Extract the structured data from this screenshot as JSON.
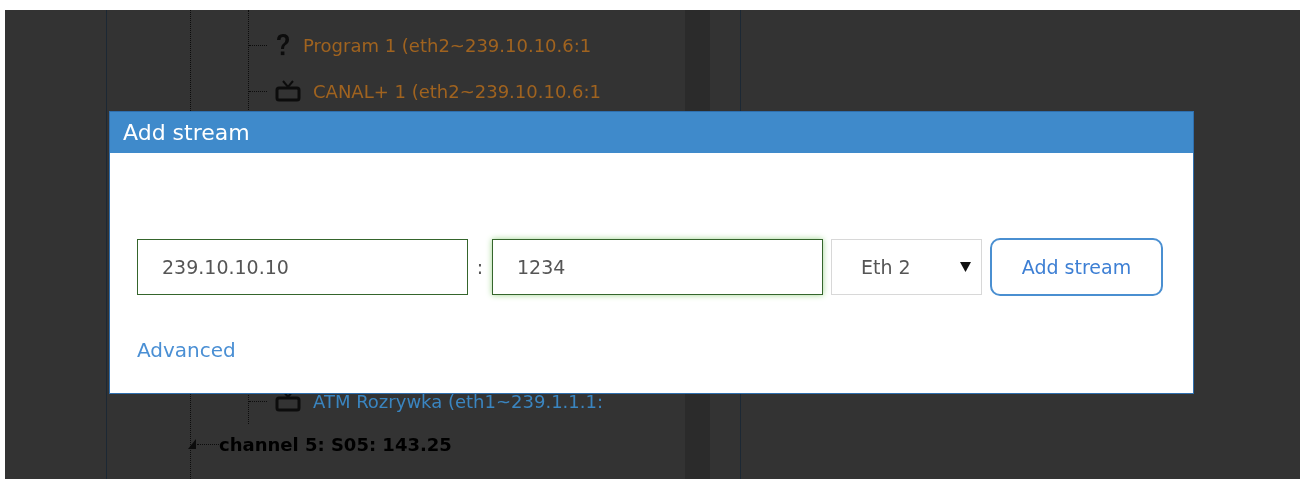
{
  "tree": {
    "channel": {
      "label": "channel 5: S05: 143.25",
      "expanded": true
    },
    "items_top": [
      {
        "kind": "unknown",
        "label": "Program 1 (eth2~239.10.10.6:1",
        "color": "#a0631f"
      },
      {
        "kind": "tv",
        "label": "CANAL+ 1 (eth2~239.10.10.6:1",
        "color": "#a0631f"
      }
    ],
    "items_bottom": [
      {
        "kind": "tv",
        "label": "ATM Rozrywka (eth1~239.1.1.1:",
        "color": "#3a85c0"
      }
    ]
  },
  "dialog": {
    "title": "Add stream",
    "address": {
      "value": "239.10.10.10"
    },
    "separator": ":",
    "port": {
      "value": "1234",
      "focused": true
    },
    "interface": {
      "value": "Eth 2"
    },
    "button": "Add stream",
    "link": "Advanced"
  }
}
